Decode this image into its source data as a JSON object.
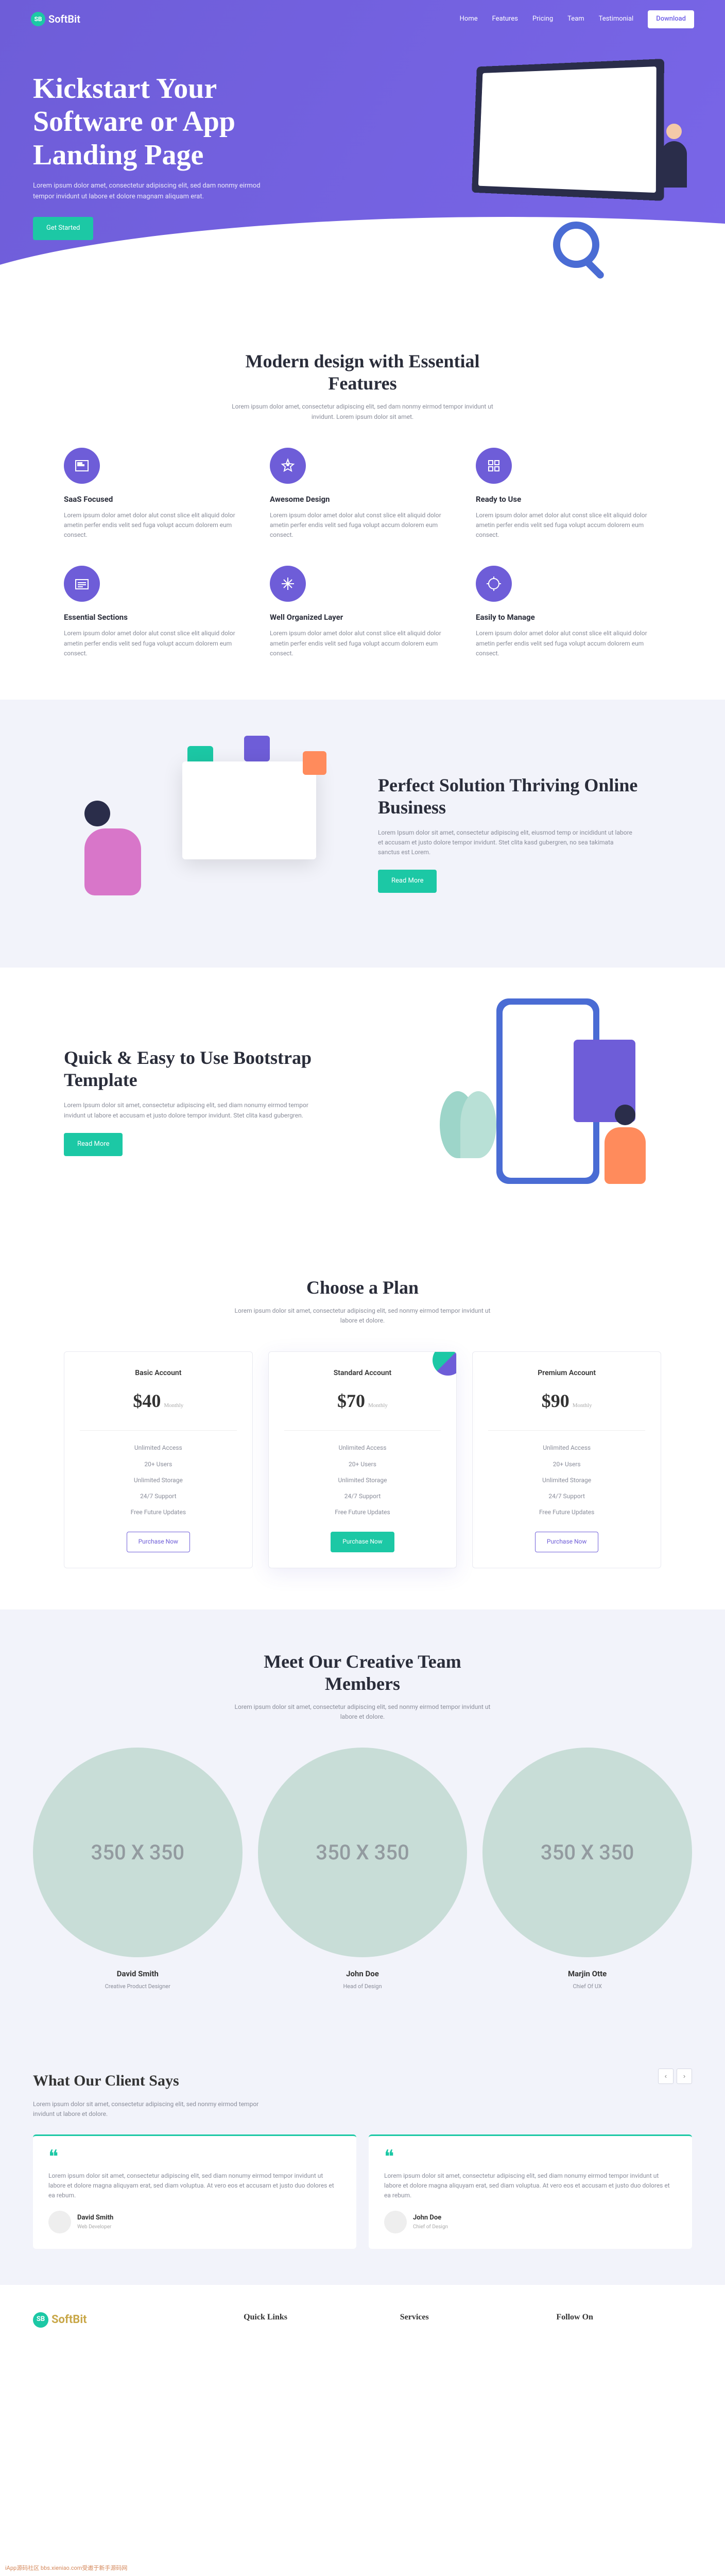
{
  "nav": {
    "logo_mark": "SB",
    "logo_text": "SoftBit",
    "links": [
      "Home",
      "Features",
      "Pricing",
      "Team",
      "Testimonial"
    ],
    "download": "Download"
  },
  "hero": {
    "title": "Kickstart Your Software or App Landing Page",
    "subtitle": "Lorem ipsum dolor amet, consectetur adipiscing elit, sed dam nonmy eirmod tempor invidunt ut labore et dolore magnam aliquam erat.",
    "cta": "Get Started"
  },
  "features": {
    "title": "Modern design with Essential Features",
    "subtitle": "Lorem ipsum dolor amet, consectetur adipiscing elit, sed dam nonmy eirmod tempor invidunt ut invidunt. Lorem ipsum dolor sit amet.",
    "items": [
      {
        "title": "SaaS Focused",
        "desc": "Lorem ipsum dolor amet dolor alut const slice elit aliquid dolor ametin perfer endis velit sed fuga volupt accum dolorem eum consect."
      },
      {
        "title": "Awesome Design",
        "desc": "Lorem ipsum dolor amet dolor alut const slice elit aliquid dolor ametin perfer endis velit sed fuga volupt accum dolorem eum consect."
      },
      {
        "title": "Ready to Use",
        "desc": "Lorem ipsum dolor amet dolor alut const slice elit aliquid dolor ametin perfer endis velit sed fuga volupt accum dolorem eum consect."
      },
      {
        "title": "Essential Sections",
        "desc": "Lorem ipsum dolor amet dolor alut const slice elit aliquid dolor ametin perfer endis velit sed fuga volupt accum dolorem eum consect."
      },
      {
        "title": "Well Organized Layer",
        "desc": "Lorem ipsum dolor amet dolor alut const slice elit aliquid dolor ametin perfer endis velit sed fuga volupt accum dolorem eum consect."
      },
      {
        "title": "Easily to Manage",
        "desc": "Lorem ipsum dolor amet dolor alut const slice elit aliquid dolor ametin perfer endis velit sed fuga volupt accum dolorem eum consect."
      }
    ]
  },
  "business": {
    "title": "Perfect Solution Thriving Online Business",
    "desc": "Lorem Ipsum dolor sit amet, consectetur adipiscing elit, eiusmod temp or incididunt ut labore et accusam et justo dolore tempor invidunt. Stet clita kasd gubergren, no sea takimata sanctus est Lorem.",
    "cta": "Read More"
  },
  "template": {
    "title": "Quick & Easy to Use Bootstrap Template",
    "desc": "Lorem Ipsum dolor sit amet, consectetur adipiscing elit, sed diam nonumy eirmod tempor invidunt ut labore et accusam et justo dolore tempor invidunt. Stet clita kasd gubergren.",
    "cta": "Read More"
  },
  "pricing": {
    "title": "Choose a Plan",
    "subtitle": "Lorem ipsum dolor sit amet, consectetur adipiscing elit, sed nonmy eirmod tempor invidunt ut labore et dolore.",
    "plans": [
      {
        "name": "Basic Account",
        "price": "$40",
        "per": "Monthly",
        "features": [
          "Unlimited Access",
          "20+ Users",
          "Unlimited Storage",
          "24/7 Support",
          "Free Future Updates"
        ],
        "cta": "Purchase Now"
      },
      {
        "name": "Standard Account",
        "price": "$70",
        "per": "Monthly",
        "features": [
          "Unlimited Access",
          "20+ Users",
          "Unlimited Storage",
          "24/7 Support",
          "Free Future Updates"
        ],
        "cta": "Purchase Now"
      },
      {
        "name": "Premium Account",
        "price": "$90",
        "per": "Monthly",
        "features": [
          "Unlimited Access",
          "20+ Users",
          "Unlimited Storage",
          "24/7 Support",
          "Free Future Updates"
        ],
        "cta": "Purchase Now"
      }
    ]
  },
  "team": {
    "title": "Meet Our Creative Team Members",
    "subtitle": "Lorem ipsum dolor sit amet, consectetur adipiscing elit, sed nonmy eirmod tempor invidunt ut labore et dolore.",
    "placeholder": "350 X 350",
    "members": [
      {
        "name": "David Smith",
        "role": "Creative Product Designer"
      },
      {
        "name": "John Doe",
        "role": "Head of Design"
      },
      {
        "name": "Marjin Otte",
        "role": "Chief Of UX"
      }
    ]
  },
  "testimonials": {
    "title": "What Our Client Says",
    "subtitle": "Lorem ipsum dolor sit amet, consectetur adipiscing elit, sed nonmy eirmod tempor invidunt ut labore et dolore.",
    "items": [
      {
        "text": "Lorem ipsum dolor sit amet, consectetur adipiscing elit, sed diam nonumy eirmod tempor invidunt ut labore et dolore magna aliquyam erat, sed diam voluptua. At vero eos et accusam et justo duo dolores et ea rebum.",
        "name": "David Smith",
        "role": "Web Developer"
      },
      {
        "text": "Lorem ipsum dolor sit amet, consectetur adipiscing elit, sed diam nonumy eirmod tempor invidunt ut labore et dolore magna aliquyam erat, sed diam voluptua. At vero eos et accusam et justo duo dolores et ea rebum.",
        "name": "John Doe",
        "role": "Chief of Design"
      }
    ]
  },
  "footer": {
    "logo_mark": "SB",
    "logo_text": "SoftBit",
    "cols": [
      "Quick Links",
      "Services",
      "Follow On"
    ]
  },
  "watermark": "iApp源码社区 bbs.xieniao.com受邀于新手源码网"
}
